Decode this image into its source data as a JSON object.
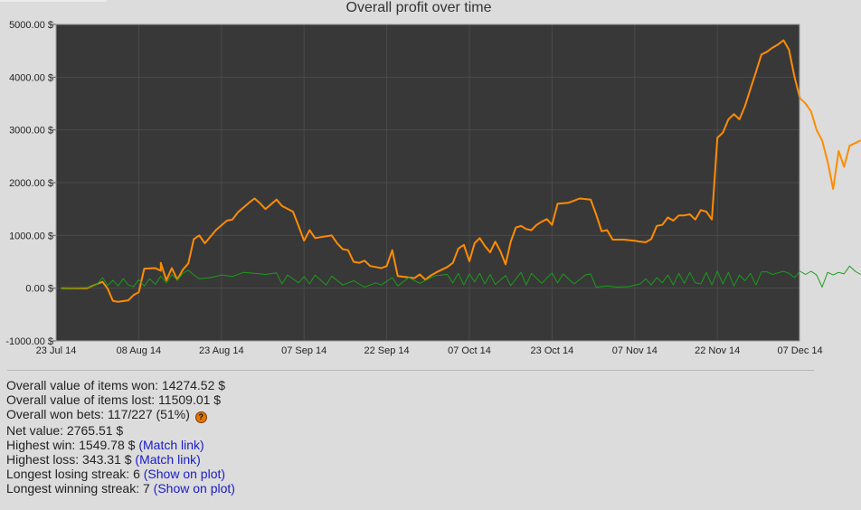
{
  "chart_data": {
    "type": "line",
    "title": "Overall profit over time",
    "x_tick_labels": [
      "23 Jul 14",
      "08 Aug 14",
      "23 Aug 14",
      "07 Sep 14",
      "22 Sep 14",
      "07 Oct 14",
      "23 Oct 14",
      "07 Nov 14",
      "22 Nov 14",
      "07 Dec 14"
    ],
    "y_tick_labels": [
      "5000.00 $",
      "4000.00 $",
      "3000.00 $",
      "2000.00 $",
      "1000.00 $",
      "0.00 $",
      "-1000.00 $"
    ],
    "ylim": [
      -1000,
      5000
    ],
    "grid": true,
    "plot_background": "#383838",
    "series": [
      {
        "color": "#ff8c00",
        "points": [
          [
            "2014-07-24",
            0
          ],
          [
            "2014-07-29",
            0
          ],
          [
            "2014-07-31",
            80
          ],
          [
            "2014-08-01",
            120
          ],
          [
            "2014-08-02",
            -10
          ],
          [
            "2014-08-03",
            -240
          ],
          [
            "2014-08-04",
            -260
          ],
          [
            "2014-08-06",
            -230
          ],
          [
            "2014-08-07",
            -130
          ],
          [
            "2014-08-08",
            -80
          ],
          [
            "2014-08-09",
            370
          ],
          [
            "2014-08-11",
            380
          ],
          [
            "2014-08-12",
            330
          ],
          [
            "2014-08-12",
            480
          ],
          [
            "2014-08-13",
            150
          ],
          [
            "2014-08-14",
            380
          ],
          [
            "2014-08-15",
            160
          ],
          [
            "2014-08-16",
            350
          ],
          [
            "2014-08-17",
            470
          ],
          [
            "2014-08-18",
            930
          ],
          [
            "2014-08-19",
            1000
          ],
          [
            "2014-08-20",
            850
          ],
          [
            "2014-08-22",
            1100
          ],
          [
            "2014-08-24",
            1280
          ],
          [
            "2014-08-25",
            1300
          ],
          [
            "2014-08-26",
            1440
          ],
          [
            "2014-08-28",
            1620
          ],
          [
            "2014-08-29",
            1700
          ],
          [
            "2014-08-30",
            1610
          ],
          [
            "2014-08-31",
            1500
          ],
          [
            "2014-09-02",
            1680
          ],
          [
            "2014-09-03",
            1560
          ],
          [
            "2014-09-05",
            1450
          ],
          [
            "2014-09-06",
            1180
          ],
          [
            "2014-09-07",
            900
          ],
          [
            "2014-09-08",
            1100
          ],
          [
            "2014-09-09",
            950
          ],
          [
            "2014-09-12",
            1000
          ],
          [
            "2014-09-13",
            850
          ],
          [
            "2014-09-14",
            740
          ],
          [
            "2014-09-15",
            720
          ],
          [
            "2014-09-16",
            500
          ],
          [
            "2014-09-17",
            480
          ],
          [
            "2014-09-18",
            520
          ],
          [
            "2014-09-19",
            420
          ],
          [
            "2014-09-20",
            400
          ],
          [
            "2014-09-21",
            380
          ],
          [
            "2014-09-22",
            420
          ],
          [
            "2014-09-23",
            720
          ],
          [
            "2014-09-24",
            230
          ],
          [
            "2014-09-27",
            190
          ],
          [
            "2014-09-28",
            260
          ],
          [
            "2014-09-29",
            160
          ],
          [
            "2014-09-30",
            240
          ],
          [
            "2014-10-01",
            300
          ],
          [
            "2014-10-03",
            400
          ],
          [
            "2014-10-04",
            480
          ],
          [
            "2014-10-05",
            750
          ],
          [
            "2014-10-06",
            820
          ],
          [
            "2014-10-07",
            510
          ],
          [
            "2014-10-08",
            850
          ],
          [
            "2014-10-09",
            950
          ],
          [
            "2014-10-10",
            800
          ],
          [
            "2014-10-11",
            680
          ],
          [
            "2014-10-12",
            880
          ],
          [
            "2014-10-13",
            700
          ],
          [
            "2014-10-14",
            450
          ],
          [
            "2014-10-15",
            880
          ],
          [
            "2014-10-16",
            1150
          ],
          [
            "2014-10-17",
            1180
          ],
          [
            "2014-10-18",
            1120
          ],
          [
            "2014-10-19",
            1100
          ],
          [
            "2014-10-20",
            1200
          ],
          [
            "2014-10-21",
            1260
          ],
          [
            "2014-10-22",
            1310
          ],
          [
            "2014-10-23",
            1200
          ],
          [
            "2014-10-24",
            1600
          ],
          [
            "2014-10-26",
            1620
          ],
          [
            "2014-10-28",
            1700
          ],
          [
            "2014-10-30",
            1680
          ],
          [
            "2014-10-31",
            1400
          ],
          [
            "2014-11-01",
            1080
          ],
          [
            "2014-11-02",
            1100
          ],
          [
            "2014-11-03",
            920
          ],
          [
            "2014-11-05",
            920
          ],
          [
            "2014-11-07",
            900
          ],
          [
            "2014-11-08",
            880
          ],
          [
            "2014-11-09",
            870
          ],
          [
            "2014-11-10",
            930
          ],
          [
            "2014-11-11",
            1180
          ],
          [
            "2014-11-12",
            1200
          ],
          [
            "2014-11-13",
            1340
          ],
          [
            "2014-11-14",
            1280
          ],
          [
            "2014-11-15",
            1380
          ],
          [
            "2014-11-16",
            1380
          ],
          [
            "2014-11-17",
            1400
          ],
          [
            "2014-11-18",
            1300
          ],
          [
            "2014-11-19",
            1480
          ],
          [
            "2014-11-20",
            1450
          ],
          [
            "2014-11-21",
            1300
          ],
          [
            "2014-11-22",
            2850
          ],
          [
            "2014-11-23",
            2950
          ],
          [
            "2014-11-24",
            3200
          ],
          [
            "2014-11-25",
            3300
          ],
          [
            "2014-11-26",
            3200
          ],
          [
            "2014-11-27",
            3450
          ],
          [
            "2014-11-28",
            3780
          ],
          [
            "2014-11-29",
            4100
          ],
          [
            "2014-11-30",
            4430
          ],
          [
            "2014-12-01",
            4480
          ],
          [
            "2014-12-02",
            4560
          ],
          [
            "2014-12-03",
            4620
          ],
          [
            "2014-12-04",
            4700
          ],
          [
            "2014-12-05",
            4520
          ],
          [
            "2014-12-06",
            4000
          ],
          [
            "2014-12-07",
            3600
          ],
          [
            "2014-12-08",
            3500
          ],
          [
            "2014-12-09",
            3350
          ],
          [
            "2014-12-10",
            3000
          ],
          [
            "2014-12-11",
            2800
          ],
          [
            "2014-12-12",
            2400
          ],
          [
            "2014-12-13",
            1880
          ],
          [
            "2014-12-14",
            2600
          ],
          [
            "2014-12-15",
            2300
          ],
          [
            "2014-12-16",
            2700
          ],
          [
            "2014-12-17",
            2750
          ],
          [
            "2014-12-18",
            2800
          ]
        ]
      },
      {
        "color": "#1a9c1a",
        "points": [
          [
            "2014-07-24",
            0
          ],
          [
            "2014-07-29",
            10
          ],
          [
            "2014-07-30",
            30
          ],
          [
            "2014-07-31",
            80
          ],
          [
            "2014-08-01",
            200
          ],
          [
            "2014-08-02",
            50
          ],
          [
            "2014-08-03",
            150
          ],
          [
            "2014-08-04",
            40
          ],
          [
            "2014-08-05",
            180
          ],
          [
            "2014-08-06",
            60
          ],
          [
            "2014-08-07",
            30
          ],
          [
            "2014-08-08",
            160
          ],
          [
            "2014-08-09",
            40
          ],
          [
            "2014-08-10",
            180
          ],
          [
            "2014-08-11",
            70
          ],
          [
            "2014-08-12",
            230
          ],
          [
            "2014-08-13",
            100
          ],
          [
            "2014-08-14",
            260
          ],
          [
            "2014-08-15",
            150
          ],
          [
            "2014-08-16",
            280
          ],
          [
            "2014-08-17",
            340
          ],
          [
            "2014-08-18",
            250
          ],
          [
            "2014-08-19",
            180
          ],
          [
            "2014-08-21",
            200
          ],
          [
            "2014-08-23",
            250
          ],
          [
            "2014-08-25",
            220
          ],
          [
            "2014-08-27",
            300
          ],
          [
            "2014-08-29",
            280
          ],
          [
            "2014-08-31",
            260
          ],
          [
            "2014-09-02",
            290
          ],
          [
            "2014-09-03",
            80
          ],
          [
            "2014-09-04",
            250
          ],
          [
            "2014-09-06",
            100
          ],
          [
            "2014-09-07",
            220
          ],
          [
            "2014-09-08",
            80
          ],
          [
            "2014-09-09",
            250
          ],
          [
            "2014-09-11",
            60
          ],
          [
            "2014-09-12",
            230
          ],
          [
            "2014-09-14",
            60
          ],
          [
            "2014-09-16",
            140
          ],
          [
            "2014-09-18",
            20
          ],
          [
            "2014-09-20",
            100
          ],
          [
            "2014-09-21",
            60
          ],
          [
            "2014-09-23",
            200
          ],
          [
            "2014-09-24",
            40
          ],
          [
            "2014-09-26",
            200
          ],
          [
            "2014-09-28",
            90
          ],
          [
            "2014-09-30",
            200
          ],
          [
            "2014-10-01",
            240
          ],
          [
            "2014-10-03",
            260
          ],
          [
            "2014-10-04",
            100
          ],
          [
            "2014-10-05",
            280
          ],
          [
            "2014-10-06",
            60
          ],
          [
            "2014-10-07",
            270
          ],
          [
            "2014-10-08",
            120
          ],
          [
            "2014-10-09",
            280
          ],
          [
            "2014-10-10",
            80
          ],
          [
            "2014-10-11",
            260
          ],
          [
            "2014-10-12",
            70
          ],
          [
            "2014-10-14",
            240
          ],
          [
            "2014-10-15",
            50
          ],
          [
            "2014-10-17",
            300
          ],
          [
            "2014-10-18",
            60
          ],
          [
            "2014-10-19",
            280
          ],
          [
            "2014-10-21",
            90
          ],
          [
            "2014-10-23",
            290
          ],
          [
            "2014-10-24",
            100
          ],
          [
            "2014-10-25",
            270
          ],
          [
            "2014-10-27",
            80
          ],
          [
            "2014-10-29",
            250
          ],
          [
            "2014-10-30",
            270
          ],
          [
            "2014-10-31",
            20
          ],
          [
            "2014-11-02",
            40
          ],
          [
            "2014-11-04",
            20
          ],
          [
            "2014-11-06",
            30
          ],
          [
            "2014-11-08",
            80
          ],
          [
            "2014-11-09",
            180
          ],
          [
            "2014-11-10",
            60
          ],
          [
            "2014-11-11",
            200
          ],
          [
            "2014-11-12",
            100
          ],
          [
            "2014-11-13",
            250
          ],
          [
            "2014-11-14",
            60
          ],
          [
            "2014-11-15",
            280
          ],
          [
            "2014-11-16",
            90
          ],
          [
            "2014-11-17",
            300
          ],
          [
            "2014-11-18",
            100
          ],
          [
            "2014-11-19",
            80
          ],
          [
            "2014-11-20",
            300
          ],
          [
            "2014-11-21",
            60
          ],
          [
            "2014-11-22",
            320
          ],
          [
            "2014-11-23",
            80
          ],
          [
            "2014-11-24",
            300
          ],
          [
            "2014-11-25",
            40
          ],
          [
            "2014-11-26",
            250
          ],
          [
            "2014-11-27",
            140
          ],
          [
            "2014-11-28",
            280
          ],
          [
            "2014-11-29",
            60
          ],
          [
            "2014-11-30",
            310
          ],
          [
            "2014-12-01",
            310
          ],
          [
            "2014-12-02",
            260
          ],
          [
            "2014-12-04",
            320
          ],
          [
            "2014-12-05",
            280
          ],
          [
            "2014-12-06",
            200
          ],
          [
            "2014-12-07",
            320
          ],
          [
            "2014-12-08",
            260
          ],
          [
            "2014-12-09",
            320
          ],
          [
            "2014-12-10",
            250
          ],
          [
            "2014-12-11",
            20
          ],
          [
            "2014-12-12",
            300
          ],
          [
            "2014-12-13",
            250
          ],
          [
            "2014-12-14",
            300
          ],
          [
            "2014-12-15",
            270
          ],
          [
            "2014-12-16",
            420
          ],
          [
            "2014-12-17",
            320
          ],
          [
            "2014-12-18",
            260
          ]
        ]
      }
    ]
  },
  "stats": {
    "items_won": "Overall value of items won: 14274.52 $",
    "items_lost": "Overall value of items lost: 11509.01 $",
    "won_bets": "Overall won bets: 117/227 (51%)",
    "won_bets_help": "?",
    "net_value": "Net value: 2765.51 $",
    "highest_win": "Highest win: 1549.78 $ ",
    "highest_win_link": "(Match link)",
    "highest_loss": "Highest loss: 343.31 $ ",
    "highest_loss_link": "(Match link)",
    "losing_streak": "Longest losing streak: 6 ",
    "losing_streak_link": "(Show on plot)",
    "winning_streak": "Longest winning streak: 7 ",
    "winning_streak_link": "(Show on plot)"
  }
}
